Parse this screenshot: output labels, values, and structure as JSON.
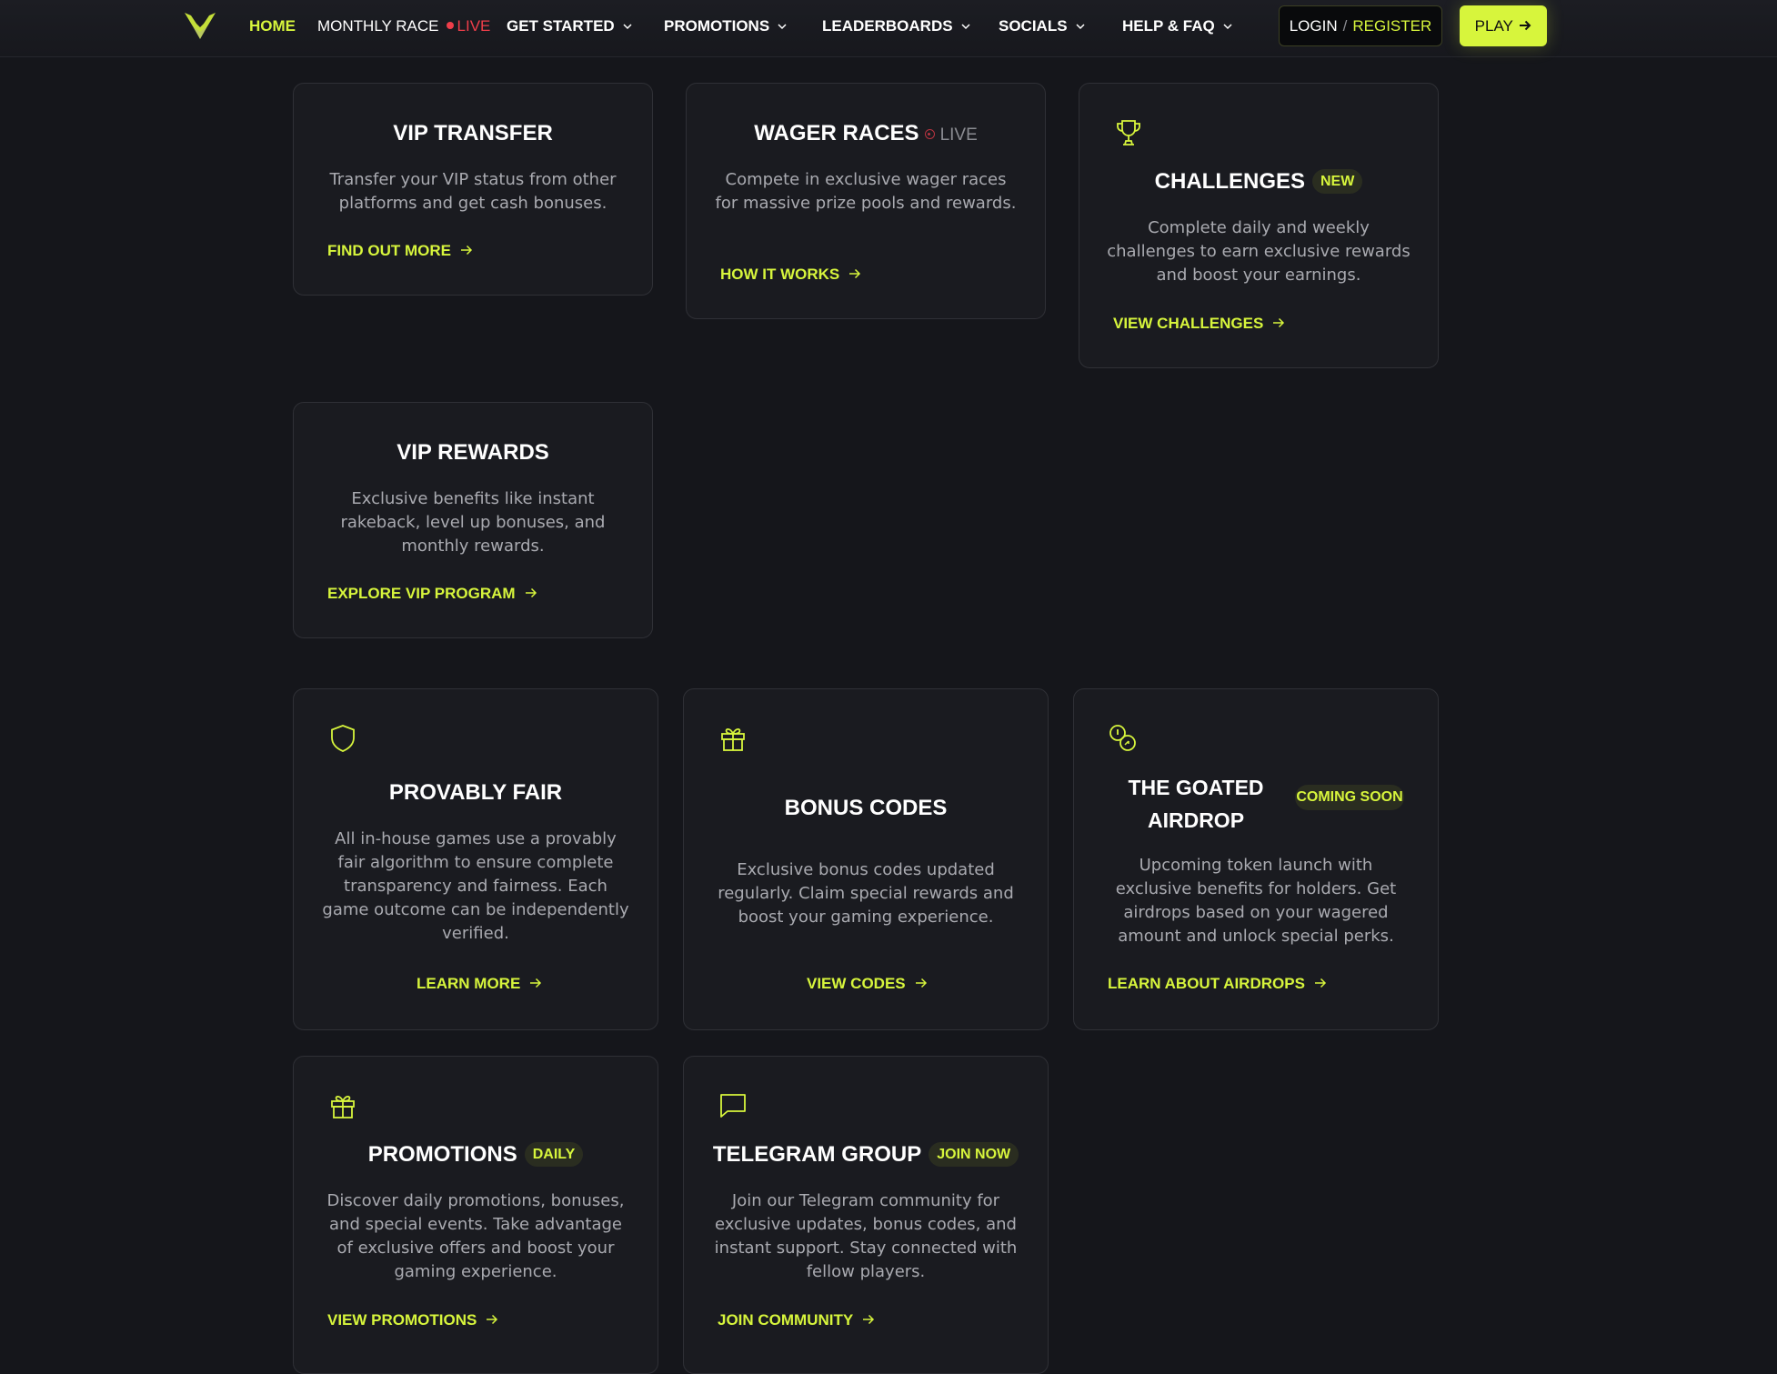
{
  "nav": {
    "logo_icon": "goat-horns-logo",
    "items": [
      {
        "label": "HOME",
        "active": true
      },
      {
        "label": "MONTHLY RACE",
        "badge": "LIVE"
      },
      {
        "label": "GET STARTED",
        "dropdown": true
      },
      {
        "label": "PROMOTIONS",
        "dropdown": true
      },
      {
        "label": "LEADERBOARDS",
        "dropdown": true
      },
      {
        "label": "SOCIALS",
        "dropdown": true
      },
      {
        "label": "HELP & FAQ",
        "dropdown": true
      }
    ],
    "login_label": "LOGIN",
    "separator": "/",
    "register_label": "REGISTER",
    "play_label": "PLAY",
    "play_icon": "arrow-right-icon"
  },
  "colors": {
    "accent": "#d7f53c",
    "background": "#15161b",
    "card": "#1a1b20",
    "live_red": "#ef3e4a"
  },
  "cards": {
    "vip_transfer": {
      "title": "VIP TRANSFER",
      "description": "Transfer your VIP status from other platforms and get cash bonuses.",
      "link": "FIND OUT MORE"
    },
    "wager_races": {
      "title": "WAGER RACES",
      "badge": "LIVE",
      "description": "Compete in exclusive wager races for massive prize pools and rewards.",
      "link": "HOW IT WORKS"
    },
    "challenges": {
      "icon": "trophy-icon",
      "title": "CHALLENGES",
      "badge": "NEW",
      "description": "Complete daily and weekly challenges to earn exclusive rewards and boost your earnings.",
      "link": "VIEW CHALLENGES"
    },
    "vip_rewards": {
      "title": "VIP REWARDS",
      "description": "Exclusive benefits like instant rakeback, level up bonuses, and monthly rewards.",
      "link": "EXPLORE VIP PROGRAM"
    },
    "provably_fair": {
      "icon": "shield-icon",
      "title": "PROVABLY FAIR",
      "description": "All in-house games use a provably fair algorithm to ensure complete transparency and fairness. Each game outcome can be independently verified.",
      "link": "LEARN MORE"
    },
    "bonus_codes": {
      "icon": "gift-icon",
      "title": "BONUS CODES",
      "description": "Exclusive bonus codes updated regularly. Claim special rewards and boost your gaming experience.",
      "link": "VIEW CODES"
    },
    "airdrop": {
      "icon": "coins-icon",
      "title": "THE GOATED AIRDROP",
      "badge": "COMING SOON",
      "description": "Upcoming token launch with exclusive benefits for holders. Get airdrops based on your wagered amount and unlock special perks.",
      "link": "LEARN ABOUT AIRDROPS"
    },
    "promotions": {
      "icon": "gift-icon",
      "title": "PROMOTIONS",
      "badge": "DAILY",
      "description": "Discover daily promotions, bonuses, and special events. Take advantage of exclusive offers and boost your gaming experience.",
      "link": "VIEW PROMOTIONS"
    },
    "telegram": {
      "icon": "chat-bubble-icon",
      "title": "TELEGRAM GROUP",
      "badge": "JOIN NOW",
      "description": "Join our Telegram community for exclusive updates, bonus codes, and instant support. Stay connected with fellow players.",
      "link": "JOIN COMMUNITY"
    }
  }
}
